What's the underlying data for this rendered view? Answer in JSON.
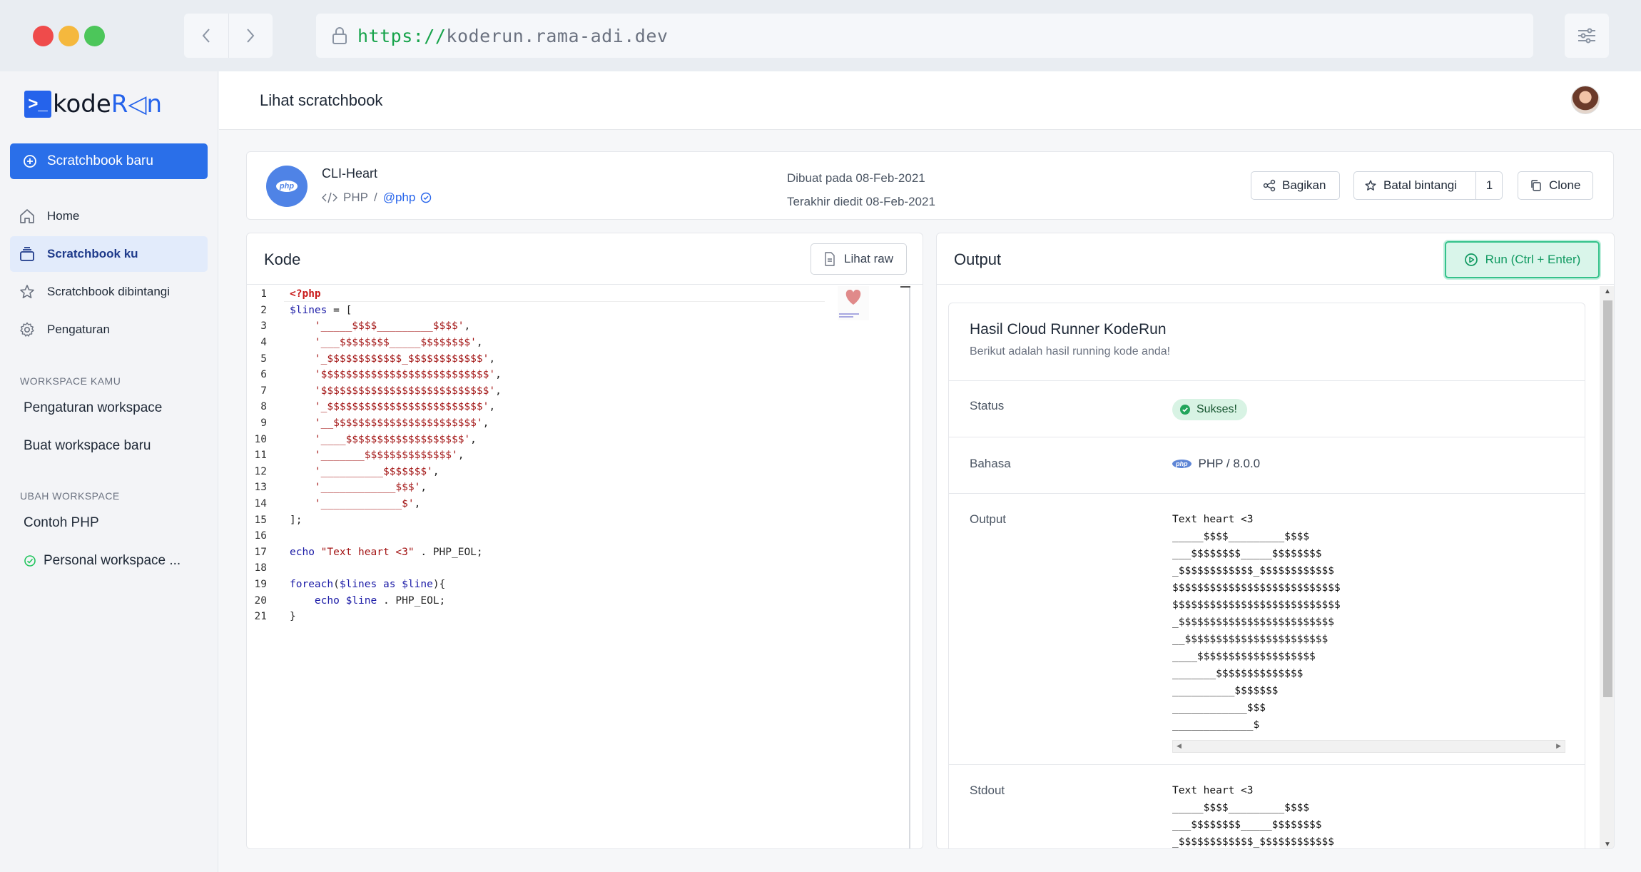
{
  "browser": {
    "url_protocol": "https://",
    "url_host": "koderun.rama-adi.dev"
  },
  "sidebar": {
    "logo_prefix": "kode",
    "logo_suffix": "R◁n",
    "new_button": "Scratchbook baru",
    "nav": [
      {
        "label": "Home",
        "icon": "home-icon"
      },
      {
        "label": "Scratchbook ku",
        "icon": "layers-icon",
        "active": true
      },
      {
        "label": "Scratchbook dibintangi",
        "icon": "star-icon"
      },
      {
        "label": "Pengaturan",
        "icon": "gear-icon"
      }
    ],
    "workspace_section": "WORKSPACE KAMU",
    "workspace_items": [
      "Pengaturan workspace",
      "Buat workspace baru"
    ],
    "switch_section": "UBAH WORKSPACE",
    "switch_items": [
      "Contoh PHP",
      "Personal workspace ..."
    ]
  },
  "header": {
    "title": "Lihat scratchbook"
  },
  "scratchbook": {
    "badge": "php",
    "name": "CLI-Heart",
    "language": "PHP",
    "separator": "/",
    "owner": "@php",
    "created": "Dibuat pada 08-Feb-2021",
    "edited": "Terakhir diedit 08-Feb-2021",
    "share_label": "Bagikan",
    "unstar_label": "Batal bintangi",
    "star_count": "1",
    "clone_label": "Clone"
  },
  "code_panel": {
    "title": "Kode",
    "raw_button": "Lihat raw",
    "lines": [
      "<?php",
      "$lines = [",
      "    '_____$$$$_________$$$$',",
      "    '___$$$$$$$$_____$$$$$$$$',",
      "    '_$$$$$$$$$$$$_$$$$$$$$$$$$',",
      "    '$$$$$$$$$$$$$$$$$$$$$$$$$$$',",
      "    '$$$$$$$$$$$$$$$$$$$$$$$$$$$',",
      "    '_$$$$$$$$$$$$$$$$$$$$$$$$$',",
      "    '__$$$$$$$$$$$$$$$$$$$$$$$',",
      "    '____$$$$$$$$$$$$$$$$$$$',",
      "    '_______$$$$$$$$$$$$$$',",
      "    '__________$$$$$$$',",
      "    '____________$$$',",
      "    '_____________$',",
      "];",
      "",
      "echo \"Text heart <3\" . PHP_EOL;",
      "",
      "foreach($lines as $line){",
      "    echo $line . PHP_EOL;",
      "}"
    ]
  },
  "output_panel": {
    "title": "Output",
    "run_button": "Run (Ctrl + Enter)",
    "card_title": "Hasil Cloud Runner KodeRun",
    "card_subtitle": "Berikut adalah hasil running kode anda!",
    "status_label": "Status",
    "status_value": "Sukses!",
    "language_label": "Bahasa",
    "language_badge": "php",
    "language_value": "PHP / 8.0.0",
    "output_label": "Output",
    "output_text": "Text heart <3\n_____$$$$_________$$$$\n___$$$$$$$$_____$$$$$$$$\n_$$$$$$$$$$$$_$$$$$$$$$$$$\n$$$$$$$$$$$$$$$$$$$$$$$$$$$\n$$$$$$$$$$$$$$$$$$$$$$$$$$$\n_$$$$$$$$$$$$$$$$$$$$$$$$$\n__$$$$$$$$$$$$$$$$$$$$$$$\n____$$$$$$$$$$$$$$$$$$$\n_______$$$$$$$$$$$$$$\n__________$$$$$$$\n____________$$$\n_____________$",
    "stdout_label": "Stdout",
    "stdout_text": "Text heart <3\n_____$$$$_________$$$$\n___$$$$$$$$_____$$$$$$$$\n_$$$$$$$$$$$$_$$$$$$$$$$$$"
  },
  "colors": {
    "primary": "#2a6fe9",
    "success": "#34c28a"
  }
}
